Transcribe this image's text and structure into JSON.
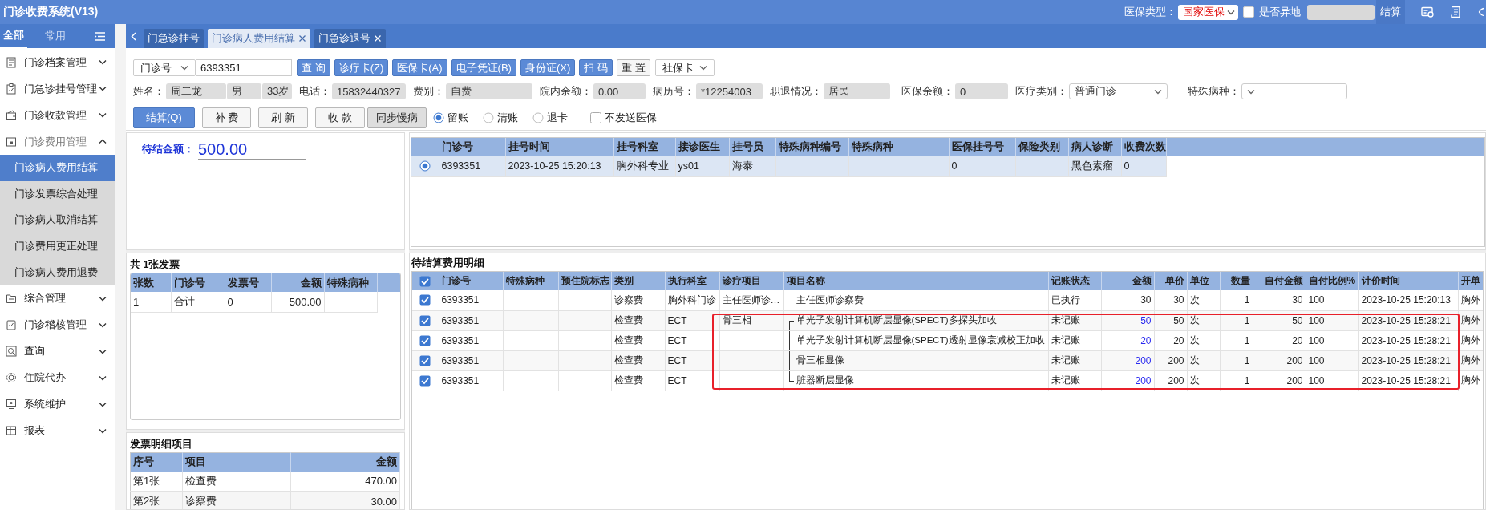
{
  "window": {
    "title": "门诊收费系统(V13)"
  },
  "header_controls": {
    "insurance_type_label": "医保类型：",
    "insurance_type": "国家医保",
    "remote_label": "是否异地",
    "remote_checked": false,
    "settle_button": "结算"
  },
  "sidebar": {
    "tabs": [
      {
        "label": "全部",
        "selected": true
      },
      {
        "label": "常用",
        "selected": false
      }
    ],
    "items": [
      {
        "label": "门诊档案管理",
        "expanded": false
      },
      {
        "label": "门急诊挂号管理",
        "expanded": false
      },
      {
        "label": "门诊收款管理",
        "expanded": false
      },
      {
        "label": "门诊费用管理",
        "expanded": true,
        "children": [
          {
            "label": "门诊病人费用结算",
            "selected": true
          },
          {
            "label": "门诊发票综合处理",
            "selected": false
          },
          {
            "label": "门诊病人取消结算",
            "selected": false
          },
          {
            "label": "门诊费用更正处理",
            "selected": false
          },
          {
            "label": "门诊病人费用退费",
            "selected": false
          }
        ]
      },
      {
        "label": "综合管理",
        "expanded": false
      },
      {
        "label": "门诊稽核管理",
        "expanded": false
      },
      {
        "label": "查询",
        "expanded": false
      },
      {
        "label": "住院代办",
        "expanded": false
      },
      {
        "label": "系统维护",
        "expanded": false
      },
      {
        "label": "报表",
        "expanded": false
      }
    ]
  },
  "tabs": [
    {
      "label": "门急诊挂号",
      "selected": false,
      "closable": false
    },
    {
      "label": "门诊病人费用结算",
      "selected": true,
      "closable": true
    },
    {
      "label": "门急诊退号",
      "selected": false,
      "closable": true
    }
  ],
  "search": {
    "id_type": "门诊号",
    "id_value": "6393351",
    "buttons": [
      {
        "label": "查 询",
        "kind": "primary"
      },
      {
        "label": "诊疗卡(Z)",
        "kind": "primary"
      },
      {
        "label": "医保卡(A)",
        "kind": "primary"
      },
      {
        "label": "电子凭证(B)",
        "kind": "primary"
      },
      {
        "label": "身份证(X)",
        "kind": "primary"
      },
      {
        "label": "扫 码",
        "kind": "primary"
      },
      {
        "label": "重 置",
        "kind": "plain"
      }
    ],
    "card_type": "社保卡"
  },
  "patient": [
    {
      "label": "姓名：",
      "kind": "readonly",
      "values": [
        "周二龙",
        "男",
        "33岁"
      ]
    },
    {
      "label": "电话：",
      "kind": "readonly",
      "values": [
        "15832440327"
      ]
    },
    {
      "label": "费别：",
      "kind": "readonly",
      "values": [
        "自费"
      ]
    },
    {
      "label": "院内余额：",
      "kind": "readonly",
      "values": [
        "0.00"
      ]
    },
    {
      "label": "病历号：",
      "kind": "readonly",
      "values": [
        "*12254003"
      ]
    },
    {
      "label": "职退情况：",
      "kind": "readonly",
      "values": [
        "居民"
      ]
    },
    {
      "label": "医保余额：",
      "kind": "readonly",
      "values": [
        "0"
      ]
    },
    {
      "label": "医疗类别：",
      "kind": "select",
      "values": [
        "普通门诊"
      ]
    },
    {
      "label": "特殊病种：",
      "kind": "select"
    }
  ],
  "actions": {
    "buttons": [
      {
        "label": "结算(Q)",
        "kind": "primary"
      },
      {
        "label": "补 费",
        "kind": "plain"
      },
      {
        "label": "刷 新",
        "kind": "plain"
      },
      {
        "label": "收 款",
        "kind": "plain"
      },
      {
        "label": "同步慢病",
        "kind": "dark"
      }
    ],
    "options": [
      {
        "label": "留账",
        "kind": "radio",
        "selected": true
      },
      {
        "label": "清账",
        "kind": "radio",
        "selected": false
      },
      {
        "label": "退卡",
        "kind": "radio",
        "selected": false
      },
      {
        "label": "不发送医保",
        "kind": "checkbox",
        "checked": false
      }
    ]
  },
  "pending_amount": {
    "label": "待结金额：",
    "value": "500.00"
  },
  "invoices": {
    "title": "共 1张发票",
    "columns": [
      {
        "label": "张数",
        "kind": "text"
      },
      {
        "label": "门诊号",
        "kind": "text"
      },
      {
        "label": "发票号",
        "kind": "text"
      },
      {
        "label": "金额",
        "kind": "numeric"
      },
      {
        "label": "特殊病种",
        "kind": "text"
      }
    ],
    "rows": [
      [
        "1",
        "合计",
        "0",
        "500.00",
        null
      ]
    ]
  },
  "invoice_items": {
    "title": "发票明细项目",
    "columns": [
      {
        "label": "序号",
        "kind": "text"
      },
      {
        "label": "项目",
        "kind": "text"
      },
      {
        "label": "金额",
        "kind": "numeric"
      }
    ],
    "rows": [
      [
        "第1张",
        "检查费",
        "470.00"
      ],
      [
        "第2张",
        "诊察费",
        "30.00"
      ]
    ]
  },
  "registration_grid": {
    "columns": [
      "门诊号",
      "挂号时间",
      "挂号科室",
      "接诊医生",
      "挂号员",
      "特殊病种编号",
      "特殊病种",
      "医保挂号号",
      "保险类别",
      "病人诊断",
      "收费次数"
    ],
    "rows": [
      {
        "selected": true,
        "cells": [
          "6393351",
          "2023-10-25 15:20:13",
          "胸外科专业",
          "ys01",
          "海泰",
          null,
          null,
          "0",
          null,
          "黑色素瘤",
          "0"
        ]
      }
    ]
  },
  "pending_fees": {
    "title": "待结算费用明细",
    "all_checked": true,
    "columns": [
      {
        "label": "门诊号",
        "kind": "text"
      },
      {
        "label": "特殊病种",
        "kind": "text"
      },
      {
        "label": "预住院标志",
        "kind": "text"
      },
      {
        "label": "类别",
        "kind": "text"
      },
      {
        "label": "执行科室",
        "kind": "text"
      },
      {
        "label": "诊疗项目",
        "kind": "text"
      },
      {
        "label": "项目名称",
        "kind": "tree"
      },
      {
        "label": "记账状态",
        "kind": "text"
      },
      {
        "label": "金额",
        "kind": "amount"
      },
      {
        "label": "单价",
        "kind": "numeric"
      },
      {
        "label": "单位",
        "kind": "text"
      },
      {
        "label": "数量",
        "kind": "numeric"
      },
      {
        "label": "自付金额",
        "kind": "numeric"
      },
      {
        "label": "自付比例%",
        "kind": "text"
      },
      {
        "label": "计价时间",
        "kind": "text"
      },
      {
        "label": "开单",
        "kind": "text"
      }
    ],
    "rows": [
      {
        "checked": true,
        "highlighted": false,
        "amount_emphasis": false,
        "grouped": false,
        "cells": [
          "6393351",
          null,
          null,
          "诊察费",
          "胸外科门诊",
          "主任医师诊…",
          "主任医师诊察费",
          "已执行",
          "30",
          "30",
          "次",
          "1",
          "30",
          "100",
          "2023-10-25 15:20:13",
          "胸外"
        ]
      },
      {
        "checked": true,
        "highlighted": true,
        "amount_emphasis": true,
        "grouped": true,
        "cells": [
          "6393351",
          null,
          null,
          "检查费",
          "ECT",
          "骨三相",
          "单光子发射计算机断层显像(SPECT)多探头加收",
          "未记账",
          "50",
          "50",
          "次",
          "1",
          "50",
          "100",
          "2023-10-25 15:28:21",
          "胸外"
        ]
      },
      {
        "checked": true,
        "highlighted": true,
        "amount_emphasis": true,
        "grouped": true,
        "cells": [
          "6393351",
          null,
          null,
          "检查费",
          "ECT",
          null,
          "单光子发射计算机断层显像(SPECT)透射显像衰减校正加收",
          "未记账",
          "20",
          "20",
          "次",
          "1",
          "20",
          "100",
          "2023-10-25 15:28:21",
          "胸外"
        ]
      },
      {
        "checked": true,
        "highlighted": true,
        "amount_emphasis": true,
        "grouped": true,
        "cells": [
          "6393351",
          null,
          null,
          "检查费",
          "ECT",
          null,
          "骨三相显像",
          "未记账",
          "200",
          "200",
          "次",
          "1",
          "200",
          "100",
          "2023-10-25 15:28:21",
          "胸外"
        ]
      },
      {
        "checked": true,
        "highlighted": true,
        "amount_emphasis": true,
        "grouped": true,
        "cells": [
          "6393351",
          null,
          null,
          "检查费",
          "ECT",
          null,
          "脏器断层显像",
          "未记账",
          "200",
          "200",
          "次",
          "1",
          "200",
          "100",
          "2023-10-25 15:28:21",
          "胸外"
        ]
      }
    ]
  }
}
